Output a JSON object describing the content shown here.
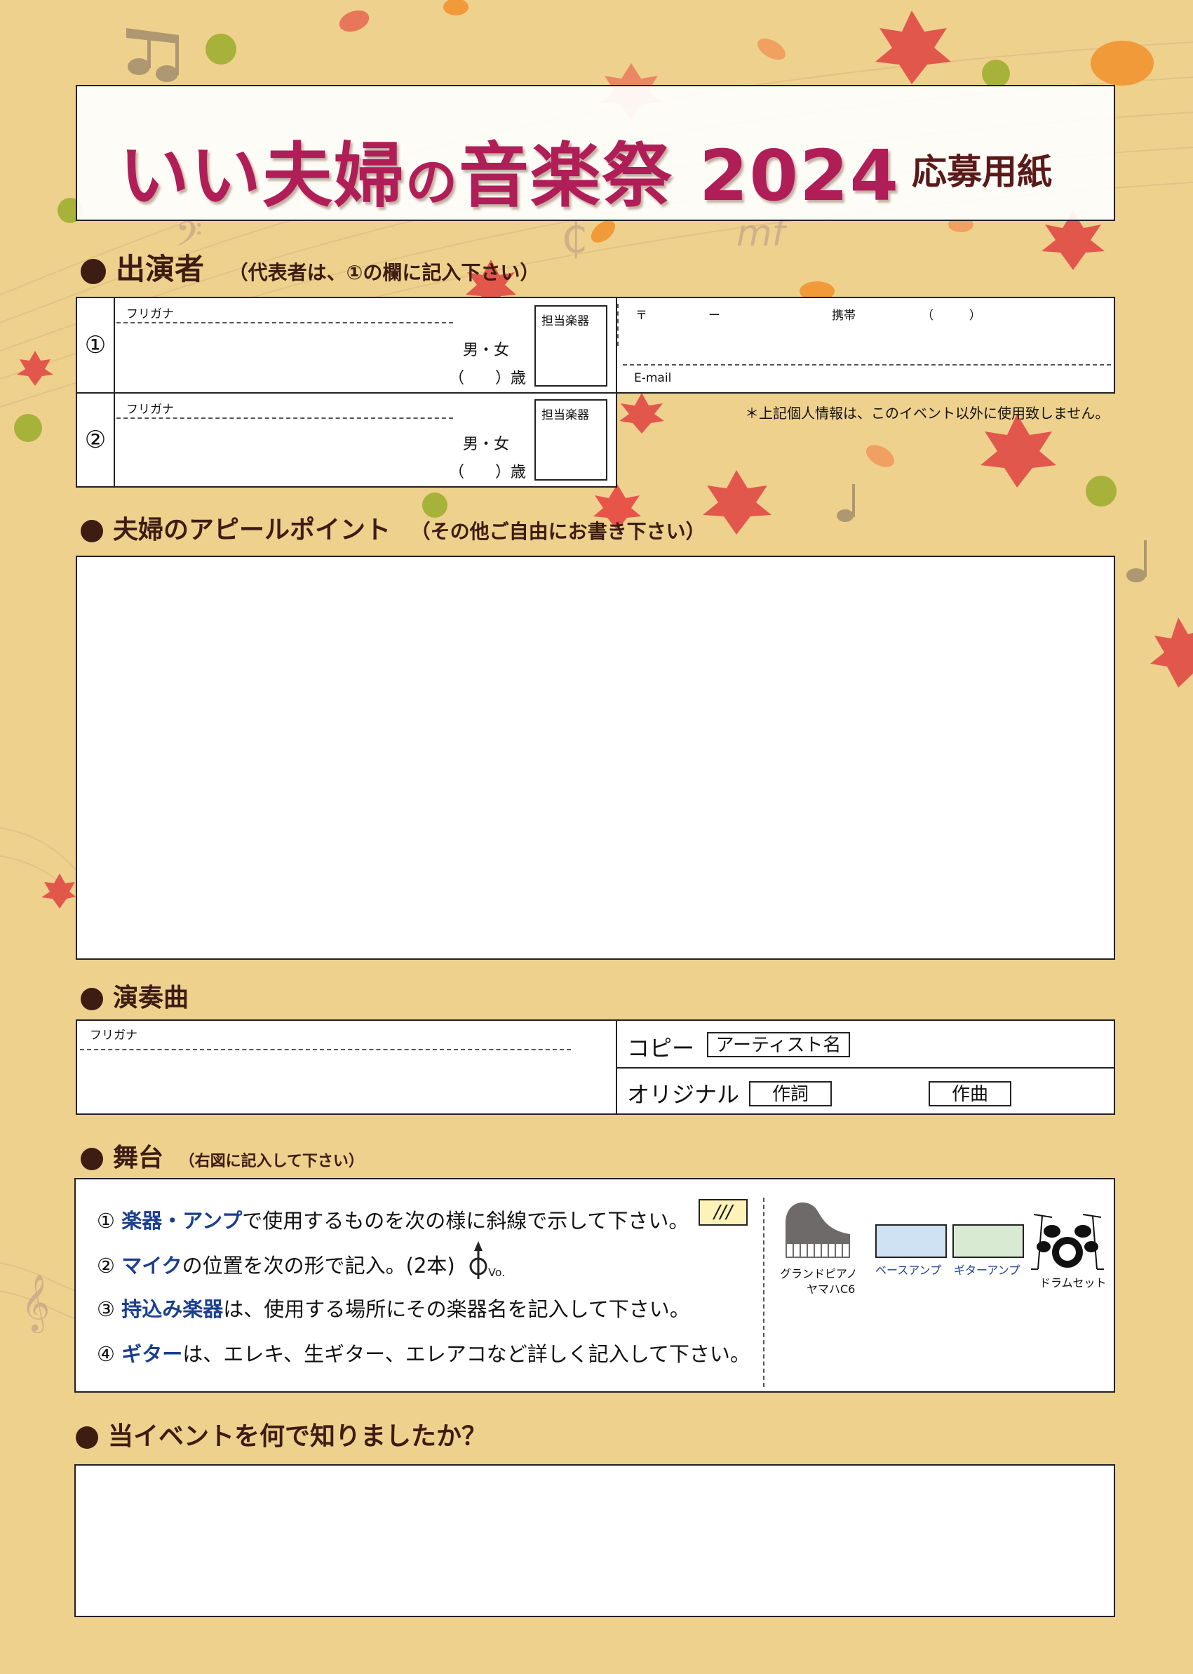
{
  "title": {
    "part1": "いい夫婦",
    "part2": "の",
    "part3": "音楽祭 2024",
    "subtitle": "応募用紙"
  },
  "performers": {
    "heading": "出演者",
    "note": "（代表者は、①の欄に記入下さい）",
    "furigana_label": "フリガナ",
    "gender": "男・女",
    "age": "（　　）歳",
    "instrument_label": "担当楽器",
    "rows": [
      {
        "num": "①"
      },
      {
        "num": "②"
      }
    ],
    "postal": "〒",
    "postal_dash": "ー",
    "mobile": "携帯",
    "mobile_paren": "（　　　）",
    "email": "E-mail",
    "privacy": "＊上記個人情報は、このイベント以外に使用致しません。"
  },
  "appeal": {
    "heading": "夫婦のアピールポイント",
    "note": "（その他ご自由にお書き下さい）"
  },
  "songs": {
    "heading": "演奏曲",
    "furigana_label": "フリガナ",
    "copy": "コピー",
    "artist": "アーティスト名",
    "original": "オリジナル",
    "lyrics": "作詞",
    "composition": "作曲"
  },
  "stage": {
    "heading": "舞台",
    "note": "（右図に記入して下さい）",
    "instructions": [
      {
        "num": "①",
        "key": "楽器・アンプ",
        "rest": "で使用するものを次の様に斜線で示して下さい。"
      },
      {
        "num": "②",
        "key": "マイク",
        "rest": "の位置を次の形で記入。(2本)"
      },
      {
        "num": "③",
        "key": "持込み楽器",
        "rest": "は、使用する場所にその楽器名を記入して下さい。"
      },
      {
        "num": "④",
        "key": "ギター",
        "rest": "は、エレキ、生ギター、エレアコなど詳しく記入して下さい。"
      }
    ],
    "hatch": "///",
    "mic_label": "Vo.",
    "piano_label1": "グランドピアノ",
    "piano_label2": "ヤマハC6",
    "bass_amp": "ベースアンプ",
    "guitar_amp": "ギターアンプ",
    "drums": "ドラムセット",
    "colors": {
      "bass_amp": "#cfe2f3",
      "guitar_amp": "#d9ead3",
      "hatch_bg": "#fdf3b8",
      "key_text": "#1b3f8f"
    }
  },
  "source_q": {
    "heading": "当イベントを何で知りましたか？"
  },
  "colors": {
    "background": "#efd18e",
    "title": "#b01e58",
    "heading": "#3d1c12"
  }
}
